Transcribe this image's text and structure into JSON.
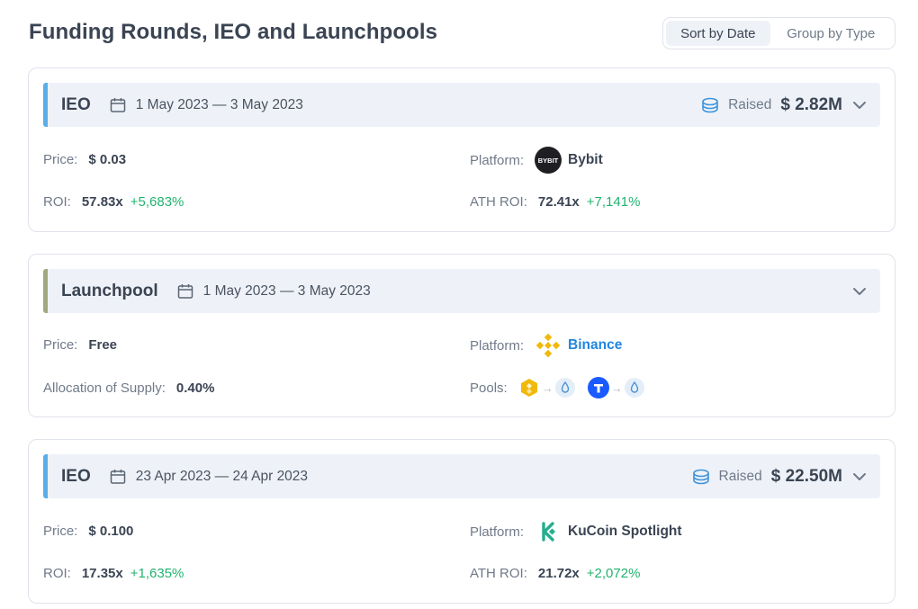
{
  "page": {
    "title": "Funding Rounds, IEO and Launchpools"
  },
  "sort": {
    "options": [
      "Sort by Date",
      "Group by Type"
    ],
    "active": "Sort by Date"
  },
  "labels": {
    "price": "Price:",
    "platform": "Platform:",
    "roi": "ROI:",
    "ath_roi": "ATH ROI:",
    "raised": "Raised",
    "allocation": "Allocation of Supply:",
    "pools": "Pools:"
  },
  "rounds": [
    {
      "type": "IEO",
      "dates": "1 May 2023 — 3 May 2023",
      "raised": "$ 2.82M",
      "price": "$ 0.03",
      "platform": "Bybit",
      "platform_logo_text": "BYBIT",
      "roi": "57.83x",
      "roi_pct": "+5,683%",
      "ath_roi": "72.41x",
      "ath_roi_pct": "+7,141%",
      "accent_color": "#5aaee8"
    },
    {
      "type": "Launchpool",
      "dates": "1 May 2023 — 3 May 2023",
      "price": "Free",
      "platform": "Binance",
      "allocation": "0.40%",
      "pools": [
        "bnb-to-token",
        "tusd-to-token"
      ],
      "accent_color": "#a3a77d"
    },
    {
      "type": "IEO",
      "dates": "23 Apr 2023 — 24 Apr 2023",
      "raised": "$ 22.50M",
      "price": "$ 0.100",
      "platform": "KuCoin Spotlight",
      "roi": "17.35x",
      "roi_pct": "+1,635%",
      "ath_roi": "21.72x",
      "ath_roi_pct": "+2,072%",
      "accent_color": "#5aaee8"
    }
  ],
  "icons": {
    "calendar": "calendar-icon",
    "coins": "coins-icon",
    "chevron": "chevron-down-icon"
  },
  "colors": {
    "positive": "#21b36e",
    "binance": "#f0b90b",
    "kucoin": "#24ae8f",
    "link": "#2186e0"
  }
}
